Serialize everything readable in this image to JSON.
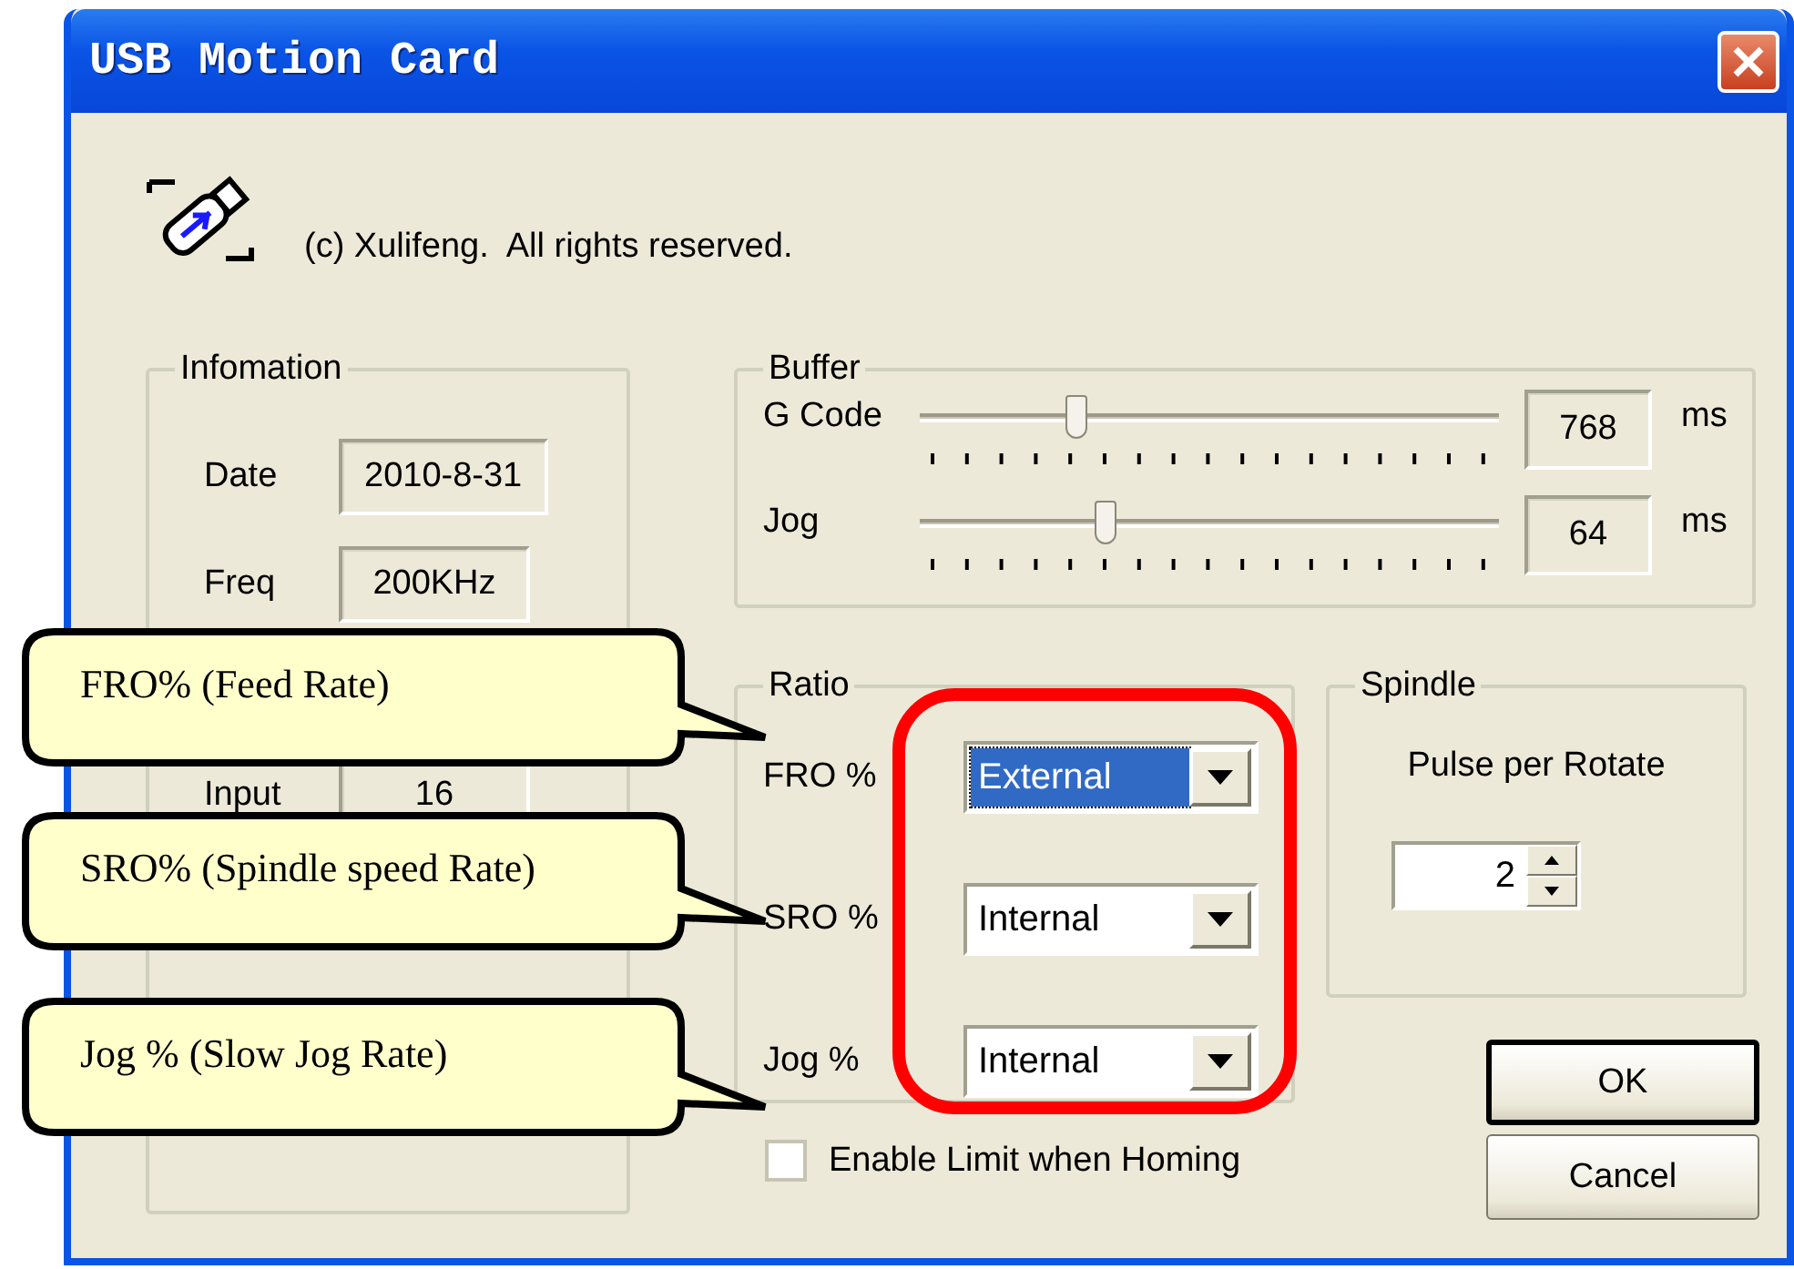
{
  "window": {
    "title": "USB Motion Card"
  },
  "copyright": "(c) Xulifeng.  All rights reserved.",
  "information": {
    "title": "Infomation",
    "rows": [
      {
        "label": "Date",
        "value": "2010-8-31"
      },
      {
        "label": "Freq",
        "value": "200KHz"
      },
      {
        "label": "Input",
        "value": "16"
      }
    ]
  },
  "buffer": {
    "title": "Buffer",
    "rows": [
      {
        "label": "G Code",
        "level": 0.27,
        "value": "768",
        "unit": "ms"
      },
      {
        "label": "Jog",
        "level": 0.32,
        "value": "64",
        "unit": "ms"
      }
    ]
  },
  "ratio": {
    "title": "Ratio",
    "rows": [
      {
        "label": "FRO %",
        "value": "External",
        "focused": true
      },
      {
        "label": "SRO %",
        "value": "Internal",
        "focused": false
      },
      {
        "label": "Jog %",
        "value": "Internal",
        "focused": false
      }
    ]
  },
  "spindle": {
    "title": "Spindle",
    "label": "Pulse per Rotate",
    "value": "2"
  },
  "enable_limit": {
    "label": "Enable Limit when Homing",
    "checked": false
  },
  "buttons": [
    {
      "label": "OK",
      "default": true
    },
    {
      "label": "Cancel",
      "default": false
    }
  ],
  "callouts": [
    {
      "text": "FRO% (Feed Rate)"
    },
    {
      "text": "SRO% (Spindle speed Rate)"
    },
    {
      "text": "Jog % (Slow Jog Rate)"
    }
  ]
}
